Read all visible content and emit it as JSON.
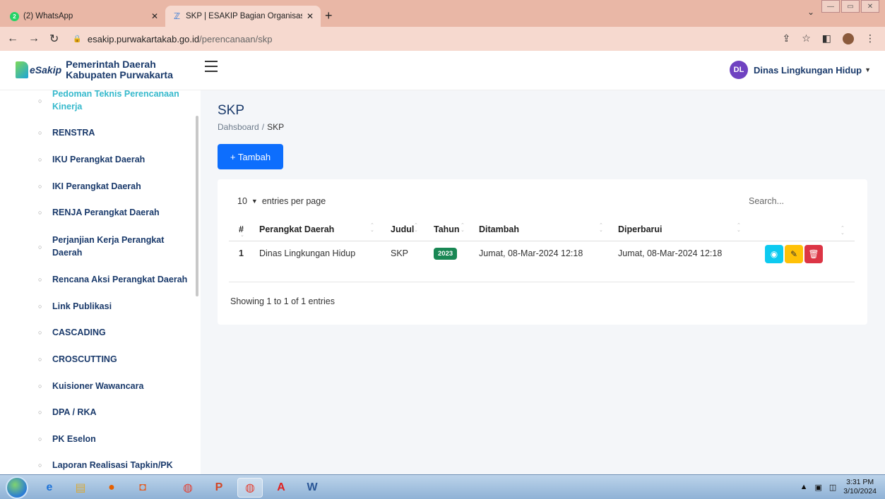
{
  "browser": {
    "tabs": [
      {
        "title": "(2) WhatsApp",
        "badge": "2"
      },
      {
        "title": "SKP | ESAKIP Bagian Organisasi S"
      }
    ],
    "url_domain": "esakip.purwakartakab.go.id",
    "url_path": "/perencanaan/skp"
  },
  "header": {
    "brand_logo_text": "eSakip",
    "brand_line1": "Pemerintah Daerah",
    "brand_line2": "Kabupaten Purwakarta",
    "user_initials": "DL",
    "user_name": "Dinas Lingkungan Hidup"
  },
  "sidebar": {
    "items": [
      {
        "label": "Pedoman Teknis Perencanaan Kinerja",
        "active": true
      },
      {
        "label": "RENSTRA"
      },
      {
        "label": "IKU Perangkat Daerah"
      },
      {
        "label": "IKI Perangkat Daerah"
      },
      {
        "label": "RENJA Perangkat Daerah"
      },
      {
        "label": "Perjanjian Kerja Perangkat Daerah"
      },
      {
        "label": "Rencana Aksi Perangkat Daerah"
      },
      {
        "label": "Link Publikasi"
      },
      {
        "label": "CASCADING"
      },
      {
        "label": "CROSCUTTING"
      },
      {
        "label": "Kuisioner Wawancara"
      },
      {
        "label": "DPA / RKA"
      },
      {
        "label": "PK Eselon"
      },
      {
        "label": "Laporan Realisasi Tapkin/PK"
      }
    ]
  },
  "main": {
    "title": "SKP",
    "breadcrumb": [
      "Dahsboard",
      "SKP"
    ],
    "add_button": "+ Tambah",
    "per_page_value": "10",
    "per_page_label": "entries per page",
    "search_placeholder": "Search...",
    "columns": [
      "#",
      "Perangkat Daerah",
      "Judul",
      "Tahun",
      "Ditambah",
      "Diperbarui"
    ],
    "rows": [
      {
        "no": "1",
        "perangkat": "Dinas Lingkungan Hidup",
        "judul": "SKP",
        "tahun": "2023",
        "ditambah": "Jumat, 08-Mar-2024 12:18",
        "diperbarui": "Jumat, 08-Mar-2024 12:18"
      }
    ],
    "showing": "Showing 1 to 1 of 1 entries"
  },
  "taskbar": {
    "time": "3:31 PM",
    "date": "3/10/2024"
  }
}
